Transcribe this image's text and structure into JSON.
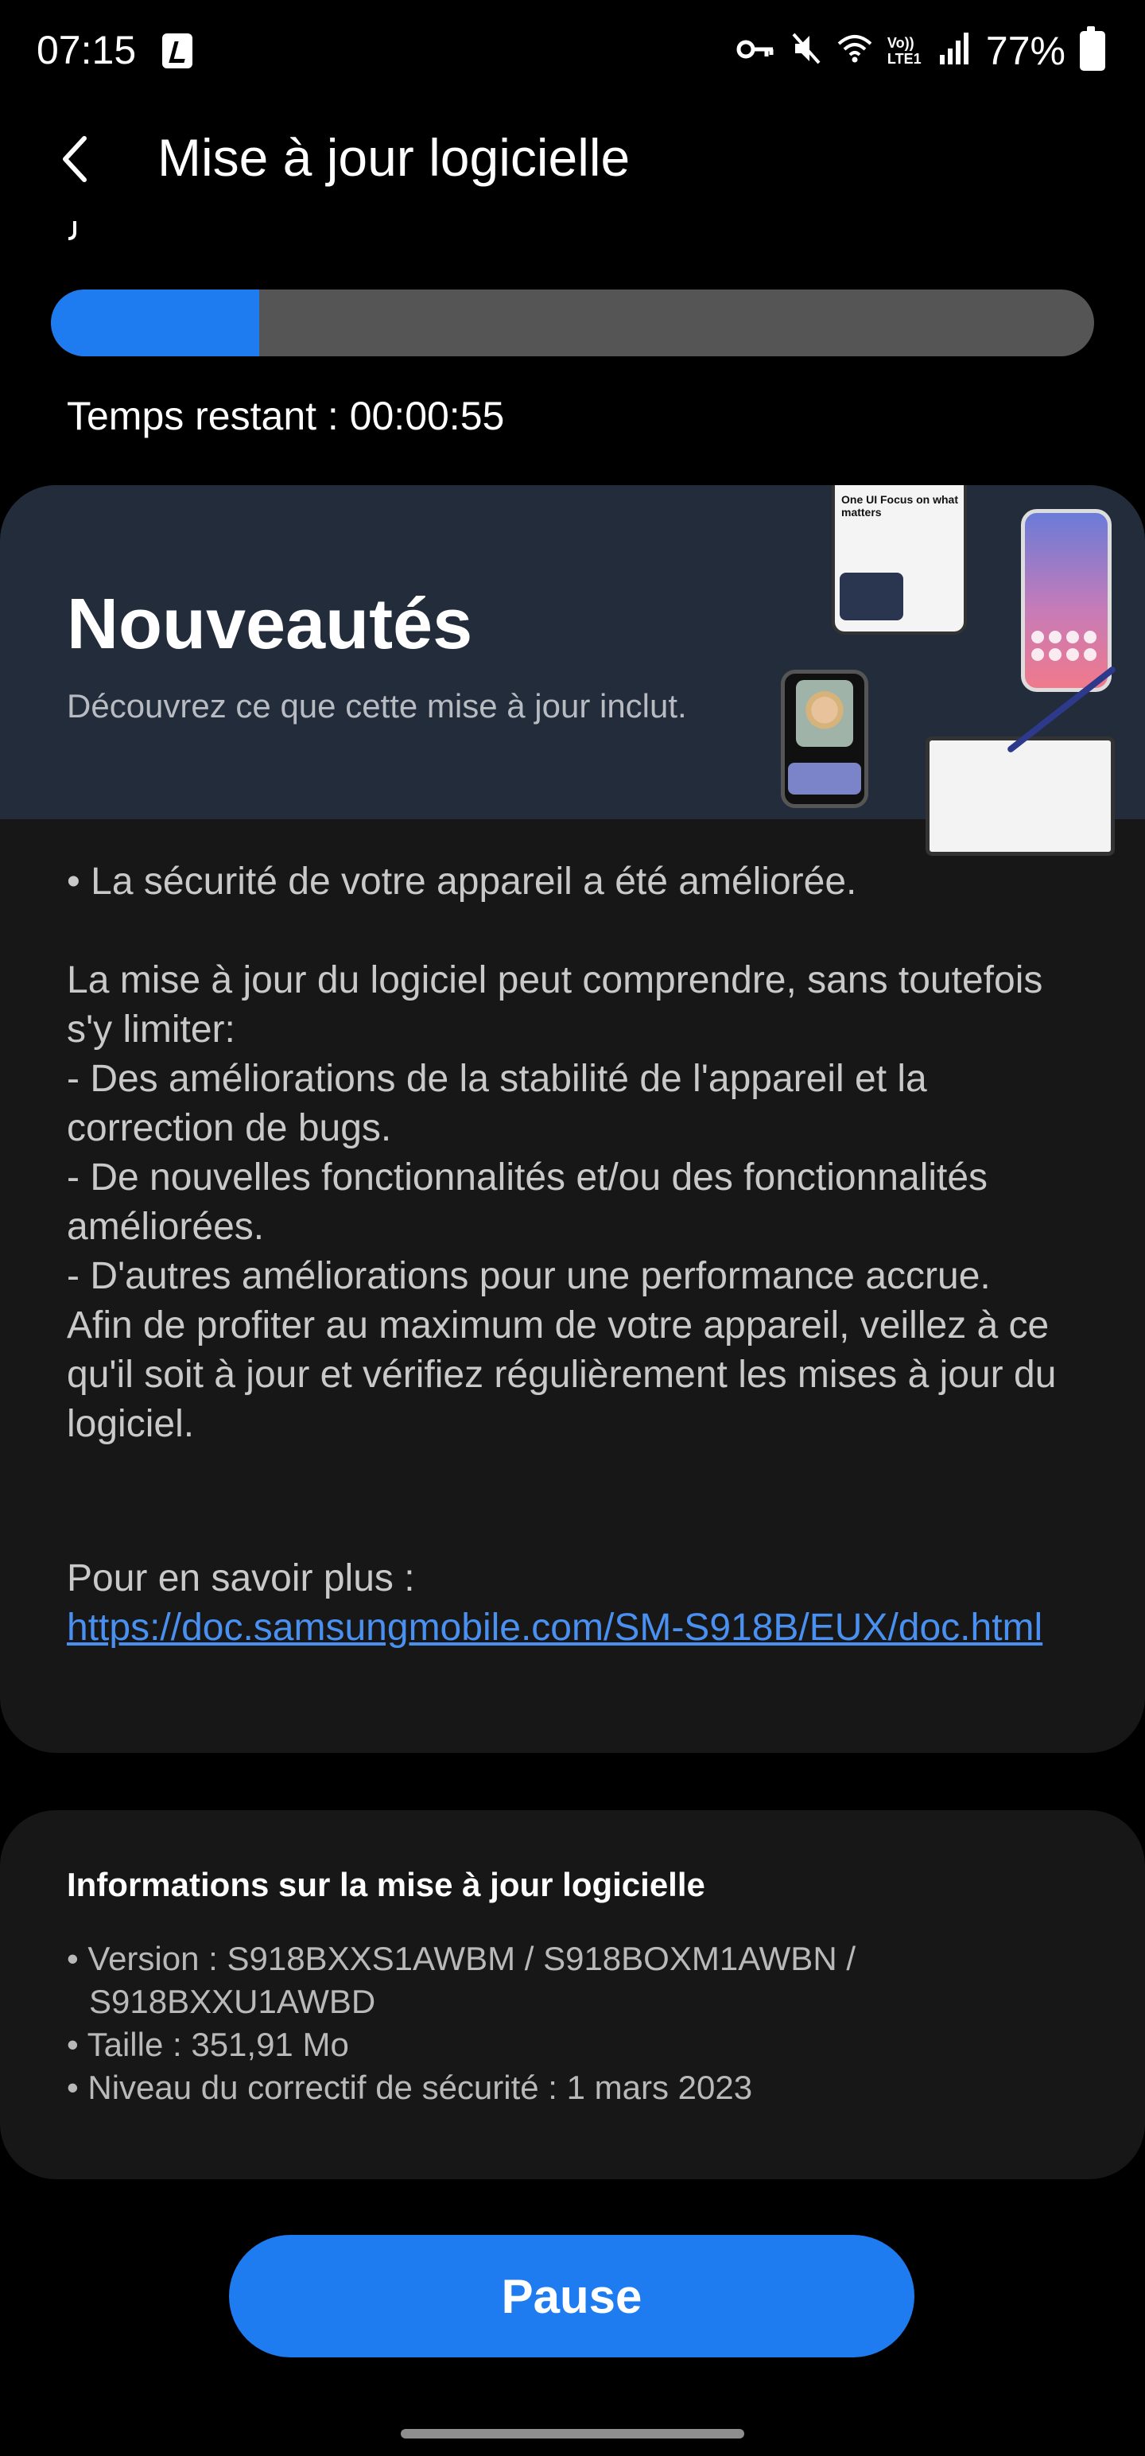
{
  "status_bar": {
    "time": "07:15",
    "icons": [
      "app-icon",
      "vpn-key-icon",
      "mute-icon",
      "wifi-icon",
      "volte-icon",
      "signal-icon"
    ],
    "volte_label": "Vo)) LTE1",
    "battery_percent": "77%"
  },
  "header": {
    "title": "Mise à jour logicielle"
  },
  "download": {
    "progress_fraction": 0.2,
    "remaining_label": "Temps restant : 00:00:55"
  },
  "whats_new": {
    "title": "Nouveautés",
    "subtitle": "Découvrez ce que cette mise à jour inclut.",
    "promo_text": "One UI Focus on what matters",
    "body_1": "• La sécurité de votre appareil a été améliorée.",
    "body_2": "La mise à jour du logiciel peut comprendre, sans toutefois s'y limiter:\n - Des améliorations de la stabilité de l'appareil et la correction de bugs.\n - De nouvelles fonctionnalités et/ou des fonctionnalités améliorées.\n - D'autres améliorations pour une performance accrue.\nAfin de profiter au maximum de votre appareil, veillez à ce qu'il soit à jour et vérifiez régulièrement les mises à jour du logiciel.",
    "more_label": "Pour en savoir plus :",
    "more_link": "https://doc.samsungmobile.com/SM-S918B/EUX/doc.html"
  },
  "update_info": {
    "title": "Informations sur la mise à jour logicielle",
    "version": "• Version : S918BXXS1AWBM / S918BOXM1AWBN / S918BXXU1AWBD",
    "size": "• Taille : 351,91 Mo",
    "security_patch": "• Niveau du correctif de sécurité : 1 mars 2023"
  },
  "actions": {
    "pause_label": "Pause"
  },
  "colors": {
    "background": "#000000",
    "card": "#171717",
    "banner": "#222c3a",
    "accent": "#1e7cf0",
    "link": "#4a90f0",
    "progress_track": "#555555"
  }
}
